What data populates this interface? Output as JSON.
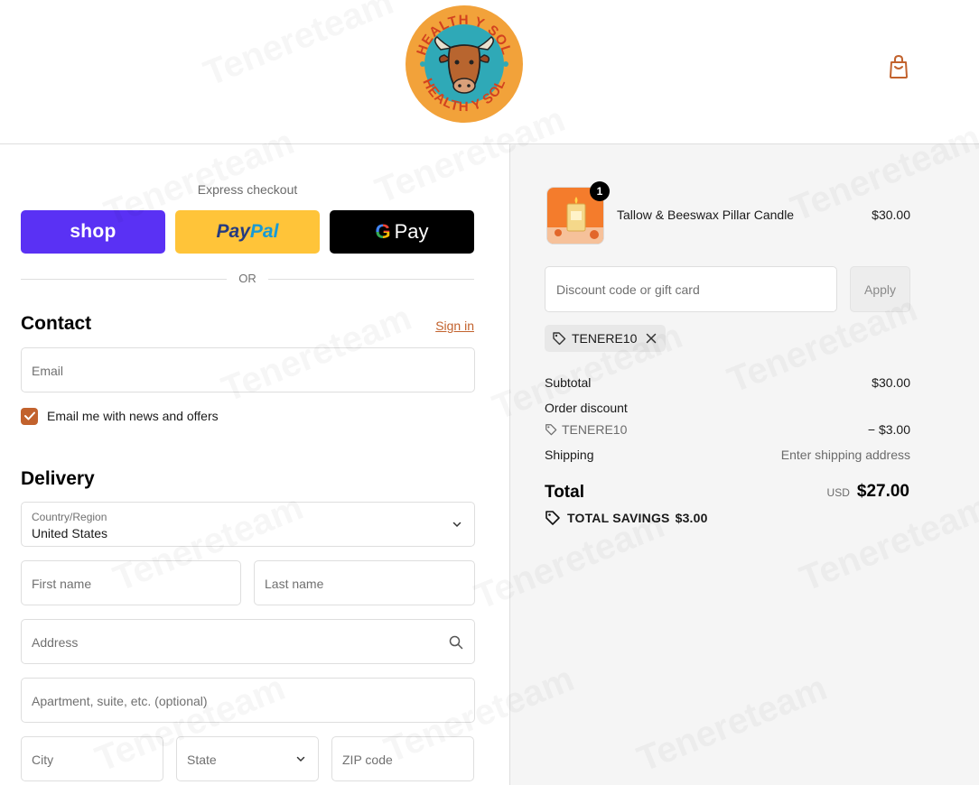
{
  "brand": {
    "logo_text_top": "HEALTH Y SOL",
    "logo_text_bottom": "HEALTH Y SOL",
    "colors": {
      "accent": "#c2622d",
      "logo_orange": "#f2a23a",
      "logo_teal": "#2fa9b7",
      "logo_red": "#d2421f"
    }
  },
  "header": {
    "cart_icon": "shopping-bag-icon"
  },
  "express": {
    "label": "Express checkout",
    "shop_label": "shop",
    "paypal_part1": "Pay",
    "paypal_part2": "Pal",
    "gpay_g": "G",
    "gpay_label": "Pay",
    "divider": "OR"
  },
  "contact": {
    "title": "Contact",
    "sign_in": "Sign in",
    "email_placeholder": "Email",
    "newsletter_label": "Email me with news and offers",
    "newsletter_checked": true
  },
  "delivery": {
    "title": "Delivery",
    "country_label": "Country/Region",
    "country_value": "United States",
    "first_name": "First name",
    "last_name": "Last name",
    "address": "Address",
    "apartment": "Apartment, suite, etc. (optional)",
    "city": "City",
    "state": "State",
    "zip": "ZIP code"
  },
  "order": {
    "item": {
      "quantity": "1",
      "name": "Tallow & Beeswax Pillar Candle",
      "price": "$30.00"
    },
    "discount_placeholder": "Discount code or gift card",
    "apply_label": "Apply",
    "applied_code": "TENERE10",
    "subtotal_label": "Subtotal",
    "subtotal_value": "$30.00",
    "order_discount_label": "Order discount",
    "discount_code": "TENERE10",
    "discount_value": "− $3.00",
    "shipping_label": "Shipping",
    "shipping_value": "Enter shipping address",
    "total_label": "Total",
    "currency": "USD",
    "total_value": "$27.00",
    "savings_label": "TOTAL SAVINGS",
    "savings_value": "$3.00"
  },
  "watermark": "Tenereteam"
}
